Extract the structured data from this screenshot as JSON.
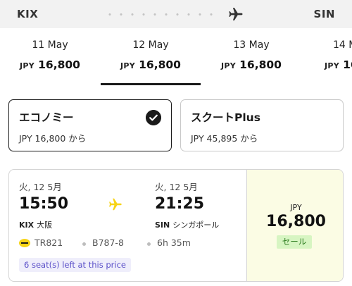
{
  "route": {
    "origin": "KIX",
    "destination": "SIN"
  },
  "date_tabs": [
    {
      "date": "11 May",
      "currency": "JPY",
      "price": "16,800",
      "selected": false
    },
    {
      "date": "12 May",
      "currency": "JPY",
      "price": "16,800",
      "selected": true
    },
    {
      "date": "13 May",
      "currency": "JPY",
      "price": "16,800",
      "selected": false
    },
    {
      "date": "14 M",
      "currency": "JPY",
      "price": "16",
      "selected": false
    }
  ],
  "fare_classes": [
    {
      "name": "エコノミー",
      "price": "JPY 16,800 から",
      "selected": true
    },
    {
      "name": "スクートPlus",
      "price": "JPY 45,895 から",
      "selected": false
    }
  ],
  "flight": {
    "departure": {
      "date": "火, 12 5月",
      "time": "15:50",
      "code": "KIX",
      "city": "大阪"
    },
    "arrival": {
      "date": "火, 12 5月",
      "time": "21:25",
      "code": "SIN",
      "city": "シンガポール"
    },
    "flight_number": "TR821",
    "aircraft": "B787-8",
    "duration": "6h 35m",
    "seats_left": "6 seat(s) left at this price",
    "price_currency": "JPY",
    "price_amount": "16,800",
    "tag": "セール"
  },
  "icons": {
    "route_plane": "airplane-icon",
    "selected_check": "check-circle-icon",
    "flight_plane": "airplane-icon",
    "airline_logo": "scoot-logo-icon"
  },
  "colors": {
    "accent_yellow": "#f7d417",
    "price_panel_bg": "#fbfce4",
    "sale_badge_bg": "#d7f5c2",
    "seats_badge_text": "#5a4fc8"
  }
}
